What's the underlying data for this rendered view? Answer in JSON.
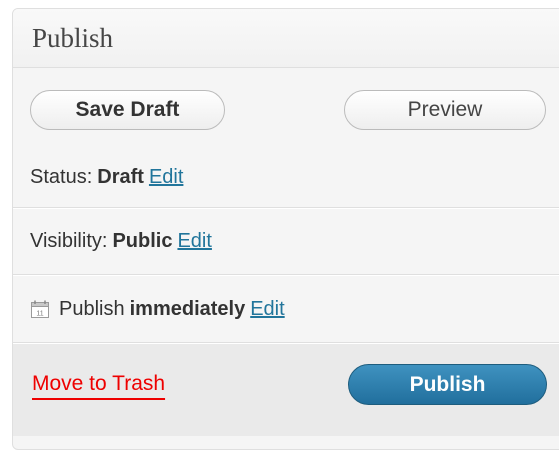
{
  "panel": {
    "title": "Publish"
  },
  "actions": {
    "save_draft_label": "Save Draft",
    "preview_label": "Preview"
  },
  "status": {
    "label": "Status:",
    "value": "Draft",
    "edit_label": "Edit"
  },
  "visibility": {
    "label": "Visibility:",
    "value": "Public",
    "edit_label": "Edit"
  },
  "schedule": {
    "icon": "calendar-icon",
    "icon_day": "11",
    "label": "Publish",
    "value": "immediately",
    "edit_label": "Edit"
  },
  "major_actions": {
    "trash_label": "Move to Trash",
    "publish_label": "Publish"
  },
  "colors": {
    "link": "#21759b",
    "trash": "#ee0000",
    "publish_button": "#2a80ae"
  }
}
